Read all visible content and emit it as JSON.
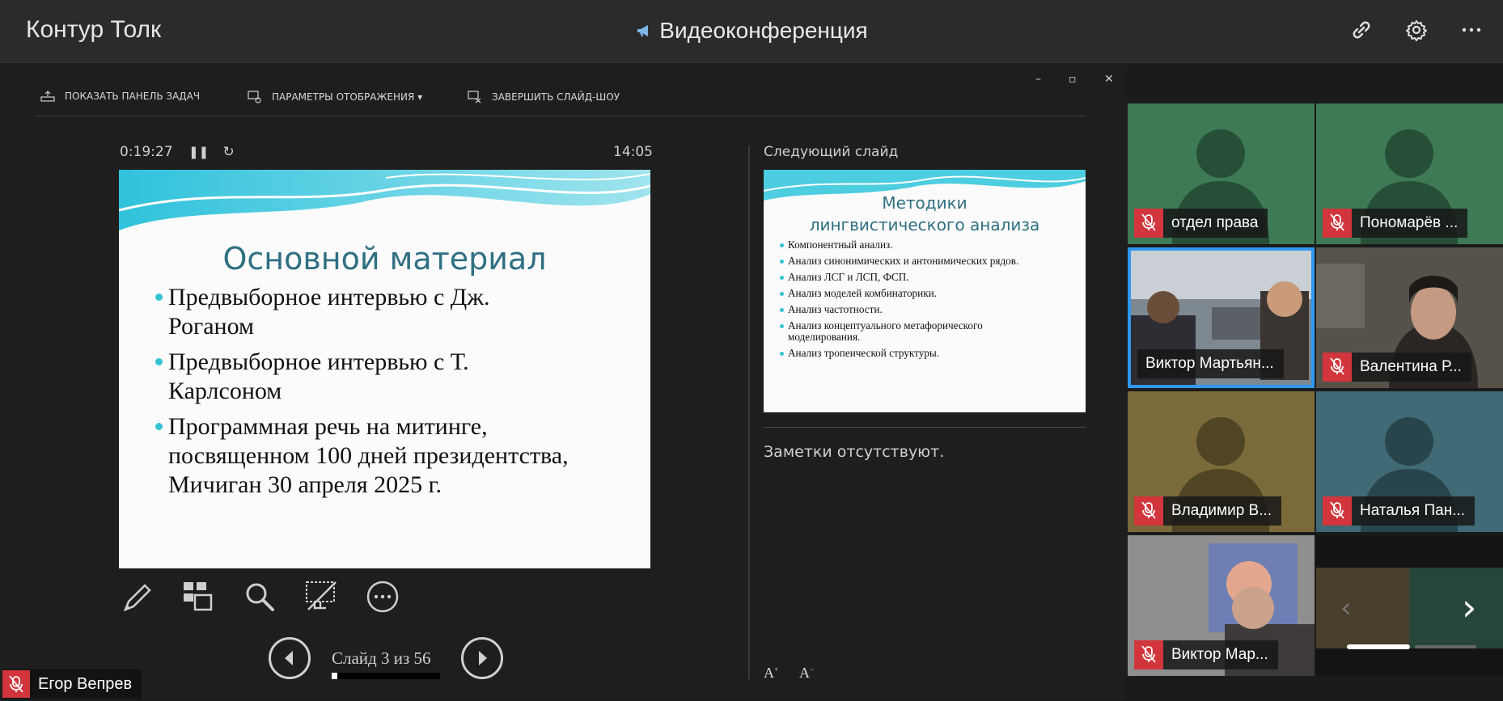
{
  "app": {
    "title": "Контур Толк",
    "conference_title": "Видеоконференция"
  },
  "top_actions": [
    {
      "icon": "link-icon"
    },
    {
      "icon": "gear-icon"
    },
    {
      "icon": "more-icon"
    }
  ],
  "presenter_toolbar": {
    "show_taskbar": "ПОКАЗАТЬ ПАНЕЛЬ ЗАДАЧ",
    "display_settings": "ПАРАМЕТРЫ ОТОБРАЖЕНИЯ ▾",
    "end_slideshow": "ЗАВЕРШИТЬ СЛАЙД-ШОУ",
    "window_controls": [
      "–",
      "▫",
      "✕"
    ]
  },
  "presenter": {
    "elapsed": "0:19:27",
    "clock": "14:05",
    "current_slide": {
      "title": "Основной материал",
      "bullets": [
        "Предвыборное интервью с Дж. Роганом",
        " Предвыборное интервью с Т. Карлсоном",
        "Программная речь на митинге, посвященном 100 дней президентства, Мичиган 30 апреля 2025 г."
      ]
    },
    "slide_counter": "Слайд 3 из 56",
    "progress_fraction": 0.054,
    "next_label": "Следующий слайд",
    "next_slide": {
      "title": "Методики лингвистического анализа",
      "bullets": [
        "Компонентный анализ.",
        "Анализ синонимических и антонимических рядов.",
        "Анализ ЛСГ и ЛСП, ФСП.",
        "Анализ моделей комбинаторики.",
        "Анализ частотности.",
        "Анализ концептуального метафорического моделирования.",
        "Анализ тропеической структуры."
      ]
    },
    "notes": "Заметки отсутствуют.",
    "font_up": "A",
    "font_down": "A"
  },
  "self_view": {
    "name": "Егор Вепрев"
  },
  "participants": [
    {
      "name": "отдел права",
      "bg": "#3d7a55",
      "muted": true
    },
    {
      "name": "Пономарёв ...",
      "bg": "#3d7a55",
      "muted": true
    },
    {
      "name": "Виктор Мартьян...",
      "bg": "#6f7a82",
      "muted": false,
      "active": true
    },
    {
      "name": "Валентина Р...",
      "bg": "#5b5850",
      "muted": true
    },
    {
      "name": "Владимир В...",
      "bg": "#7b6a3a",
      "muted": true
    },
    {
      "name": "Наталья Пан...",
      "bg": "#3f6a76",
      "muted": true
    },
    {
      "name": "Виктор Мар...",
      "bg": "#8e8e8e",
      "muted": true
    }
  ],
  "colors": {
    "accent": "#2f97f4",
    "muted": "#d2353c",
    "slide_title": "#2f6f82",
    "bullet": "#35c3d3"
  }
}
